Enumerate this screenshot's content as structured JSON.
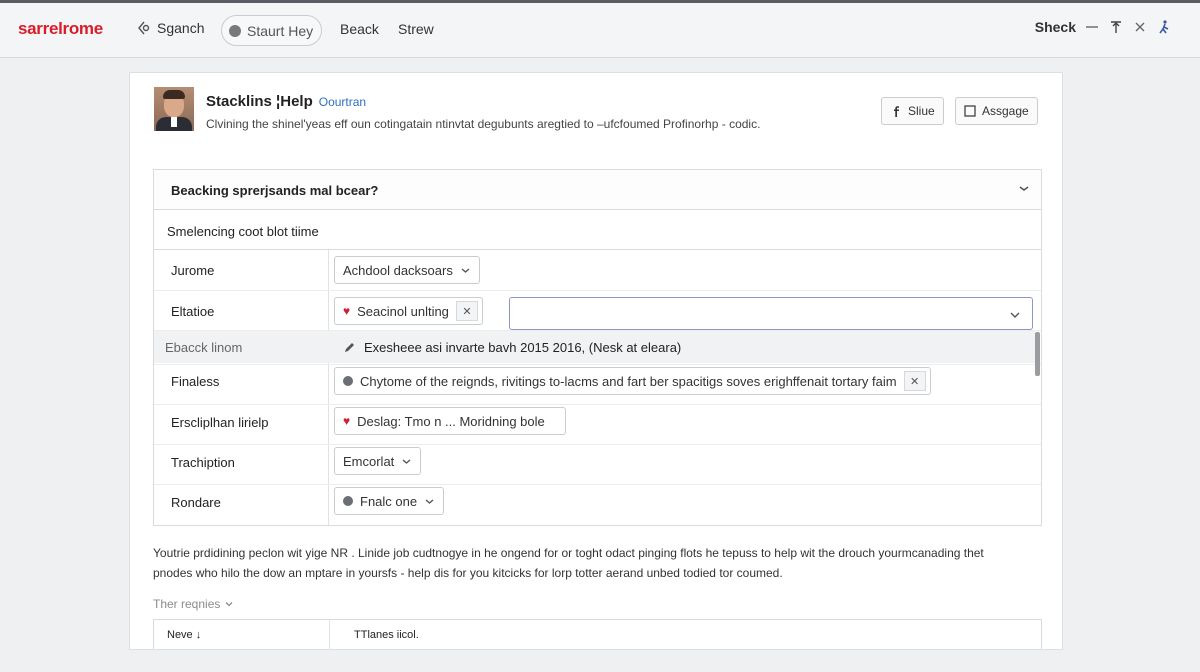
{
  "topbar": {
    "logo": "sarrelrome",
    "search_label": "Sganch",
    "start_pill": "Staurt Hey",
    "links": [
      "Beack",
      "Strew"
    ],
    "right_label": "Sheck"
  },
  "profile": {
    "title": "Stacklins ¦Help",
    "title_link": "Oourtran",
    "subtitle": "Clvining the shinel'yeas eff oun cotingatain ntinvtat degubunts aregtied to –ufcfoumed Profinorhp - codic.",
    "buttons": {
      "share": "Sliue",
      "assign": "Assgage"
    }
  },
  "panel": {
    "question": "Beacking sprerjsands mal bcear?",
    "section_title": "Smelencing coot blot tiime",
    "rows": [
      {
        "label": "Jurome",
        "value": "Achdool dacksoars"
      },
      {
        "label": "Eltatioe",
        "value": "Seacinol unlting"
      },
      {
        "label": "Ebacck linom",
        "value": "Exesheee asi invarte bavh 2015 2016, (Nesk at eleara)"
      },
      {
        "label": "Finaless",
        "value": "Chytome of the reignds, rivitings to-lacms and fart ber spacitigs soves erighffenait tortary faim"
      },
      {
        "label": "Erscliplhan lirielp",
        "value": "Deslag: Tmo n ... Moridning bole"
      },
      {
        "label": "Trachiption",
        "value": "Emcorlat"
      },
      {
        "label": "Rondare",
        "value": "Fnalc one"
      }
    ]
  },
  "footer": {
    "line1": "Youtrie prdidining peclon wit yige NR . Linide job cudtnogye in he ongend for or toght odact pinging flots he tepuss to help wit the drouch yourmcanading thet",
    "line2": "pnodes who hilo the dow an mptare in yoursfs - help dis for you kitcicks for lorp totter aerand unbed todied tor coumed.",
    "requirements": "Ther reqnies",
    "table_headers": [
      "Neve ↓",
      "TTlanes iicol."
    ]
  },
  "colors": {
    "accent": "#d81e2a",
    "link": "#2f6fbf"
  }
}
